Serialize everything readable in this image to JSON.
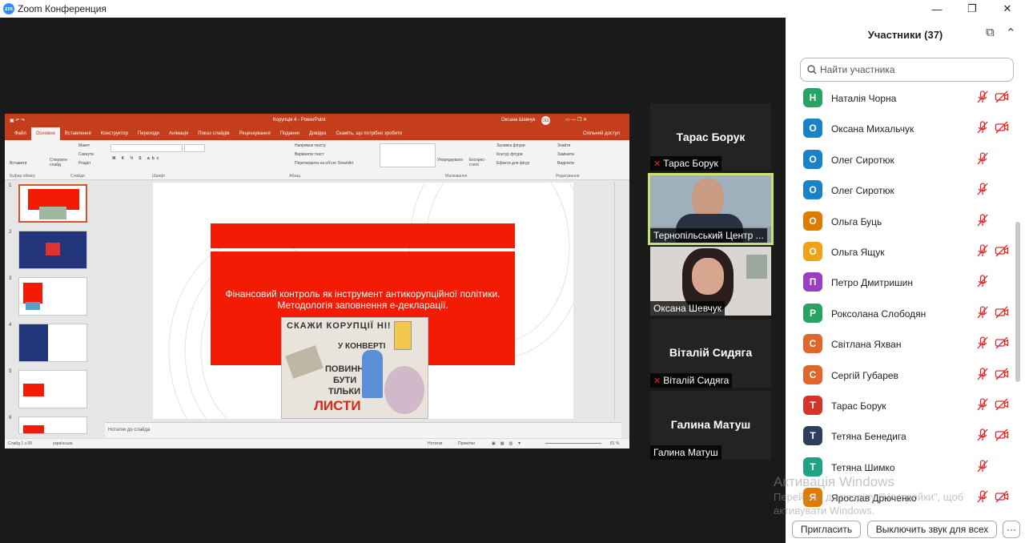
{
  "window": {
    "title": "Zoom Конференция",
    "logo_text": "zm",
    "minimize": "—",
    "maximize": "❐",
    "close": "✕"
  },
  "ppt": {
    "doc_title": "Корупція 4  -  PowerPoint",
    "user": "Оксана Шевчук",
    "user_initials": "ОШ",
    "share_label": "Спільний доступ",
    "tabs": [
      "Файл",
      "Основне",
      "Вставлення",
      "Конструктор",
      "Переходи",
      "Анімація",
      "Показ слайдів",
      "Рецензування",
      "Подання",
      "Довідка",
      "Скажіть, що потрібно зробити"
    ],
    "ribbon": {
      "paste": "Вставити",
      "clipboard_group": "Буфер обміну",
      "new_slide": "Створити слайд",
      "layout": "Макет",
      "reset": "Скинути",
      "section": "Розділ",
      "slides_group": "Слайди",
      "font_group": "Шрифт",
      "paragraph_group": "Абзац",
      "text_direction": "Напрямок тексту",
      "align_text": "Вирівняти текст",
      "smartart": "Перетворити на об'єкт SmartArt",
      "arrange": "Упорядкувати",
      "quick_styles": "Експрес-стилі",
      "shape_fill": "Заливка фігури",
      "shape_outline": "Контур фігури",
      "shape_effects": "Ефекти для фігур",
      "drawing_group": "Малювання",
      "find": "Знайти",
      "replace": "Замінити",
      "select": "Виділити",
      "editing_group": "Редагування"
    },
    "thumbs": [
      "1",
      "2",
      "3",
      "4",
      "5",
      "6"
    ],
    "slide_text_line1": "Фінансовий контроль як інструмент антикорупційної політики.",
    "slide_text_line2": "Методологія заповнення е-декларації.",
    "poster_line1": "СКАЖИ КОРУПЦІЇ НІ!",
    "poster_line2": "У КОНВЕРТІ",
    "poster_line3": "ПОВИННІ",
    "poster_line4": "БУТИ",
    "poster_line5": "ТІЛЬКИ",
    "poster_line6": "ЛИСТИ",
    "notes": "Нотатки до слайда",
    "status": {
      "slide_of": "Слайд 1 з 99",
      "language": "українська",
      "notes_btn": "Нотатки",
      "comments_btn": "Примітки",
      "zoom": "81 %"
    }
  },
  "tiles": {
    "t1_name": "Тарас Борук",
    "t1_label": "Тарас Борук",
    "t2_label": "Тернопільський Центр ...",
    "t3_label": "Оксана Шевчук",
    "t4_name": "Віталій Сидяга",
    "t4_label": "Віталій Сидяга",
    "t5_name": "Галина Матуш",
    "t5_label": "Галина Матуш",
    "active_speaker_color": "#c9e26e"
  },
  "panel": {
    "title": "Участники (37)",
    "popout_icon": "popout-icon",
    "collapse_icon": "chevron-up-icon",
    "search_placeholder": "Найти участника",
    "participants": [
      {
        "initial": "Н",
        "name": "Наталія Чорна",
        "color": "#27a363",
        "cam_off": true
      },
      {
        "initial": "О",
        "name": "Оксана Михальчук",
        "color": "#1a82c9",
        "cam_off": true
      },
      {
        "initial": "О",
        "name": "Олег Сиротюк",
        "color": "#1a82c9",
        "cam_off": false
      },
      {
        "initial": "О",
        "name": "Олег Сиротюк",
        "color": "#1a82c9",
        "cam_off": false
      },
      {
        "initial": "О",
        "name": "Ольга Буць",
        "color": "#e07b00",
        "cam_off": false
      },
      {
        "initial": "О",
        "name": "Ольга Ящук",
        "color": "#f0a319",
        "cam_off": true
      },
      {
        "initial": "П",
        "name": "Петро Дмитришин",
        "color": "#9a3fc0",
        "cam_off": false
      },
      {
        "initial": "Р",
        "name": "Роксолана Слободян",
        "color": "#27a363",
        "cam_off": true
      },
      {
        "initial": "С",
        "name": "Світлана Яхван",
        "color": "#e0662b",
        "cam_off": true
      },
      {
        "initial": "С",
        "name": "Сергій Губарев",
        "color": "#e0662b",
        "cam_off": true
      },
      {
        "initial": "Т",
        "name": "Тарас Борук",
        "color": "#d6332c",
        "cam_off": true
      },
      {
        "initial": "Т",
        "name": "Тетяна Бенедига",
        "color": "#2c3e5c",
        "cam_off": true
      },
      {
        "initial": "Т",
        "name": "Тетяна Шимко",
        "color": "#1ea383",
        "cam_off": false
      },
      {
        "initial": "Я",
        "name": "Ярослав Дрюченко",
        "color": "#e07b00",
        "cam_off": true
      }
    ],
    "invite_btn": "Пригласить",
    "mute_all_btn": "Выключить звук для всех",
    "more_btn": "···"
  },
  "watermark": {
    "line1": "Активація Windows",
    "line2": "Перейдіть до розділу \"Настройки\", щоб",
    "line3": "активувати Windows."
  }
}
